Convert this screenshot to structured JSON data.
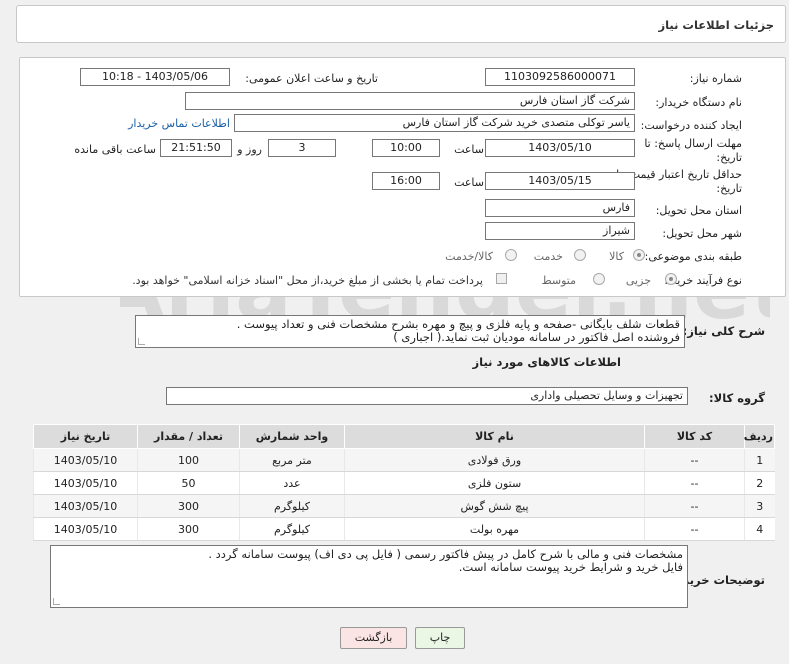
{
  "header": {
    "title": "جزئیات اطلاعات نیاز"
  },
  "form": {
    "need_number_label": "شماره نیاز:",
    "need_number": "1103092586000071",
    "announce_label": "تاریخ و ساعت اعلان عمومی:",
    "announce_value": "1403/05/06 - 10:18",
    "buyer_org_label": "نام دستگاه خریدار:",
    "buyer_org": "شرکت گاز استان فارس",
    "requester_label": "ایجاد کننده درخواست:",
    "requester": "یاسر توکلی متصدی خرید شرکت گاز استان فارس",
    "contact_link": "اطلاعات تماس خریدار",
    "reply_deadline_label_1": "مهلت ارسال پاسخ: تا",
    "reply_deadline_label_2": "تاریخ:",
    "reply_date": "1403/05/10",
    "time_label": "ساعت",
    "reply_time": "10:00",
    "days_value": "3",
    "days_label": "روز و",
    "remaining_time": "21:51:50",
    "remaining_label": "ساعت باقی مانده",
    "price_validity_label_1": "حداقل تاریخ اعتبار قیمت: تا",
    "price_validity_label_2": "تاریخ:",
    "price_date": "1403/05/15",
    "price_time": "16:00",
    "province_label": "استان محل تحویل:",
    "province": "فارس",
    "city_label": "شهر محل تحویل:",
    "city": "شیراز",
    "category_label": "طبقه بندی موضوعی:",
    "category_options": [
      "کالا",
      "خدمت",
      "کالا/خدمت"
    ],
    "purchase_type_label": "نوع فرآیند خرید :",
    "purchase_options": [
      "جزیی",
      "متوسط"
    ],
    "payment_note": "پرداخت تمام یا بخشی از مبلغ خرید،از محل \"اسناد خزانه اسلامی\" خواهد بود."
  },
  "description": {
    "label": "شرح کلی نیاز:",
    "line1": "قطعات شلف بایگانی -صفحه و پایه فلزی و پیچ و مهره بشرح مشخصات فنی و تعداد پیوست .",
    "line2": "فروشنده اصل فاکتور در سامانه مودیان ثبت نماید.( اجباری )"
  },
  "goods": {
    "section_title": "اطلاعات کالاهای مورد نیاز",
    "group_label": "گروه کالا:",
    "group_value": "تجهیزات و وسایل تحصیلی واداری",
    "columns": [
      "ردیف",
      "کد کالا",
      "نام کالا",
      "واحد شمارش",
      "تعداد / مقدار",
      "تاریخ نیاز"
    ],
    "rows": [
      {
        "idx": "1",
        "code": "--",
        "name": "ورق فولادی",
        "unit": "متر مربع",
        "qty": "100",
        "date": "1403/05/10"
      },
      {
        "idx": "2",
        "code": "--",
        "name": "ستون فلزی",
        "unit": "عدد",
        "qty": "50",
        "date": "1403/05/10"
      },
      {
        "idx": "3",
        "code": "--",
        "name": "پیچ شش گوش",
        "unit": "کیلوگرم",
        "qty": "300",
        "date": "1403/05/10"
      },
      {
        "idx": "4",
        "code": "--",
        "name": "مهره بولت",
        "unit": "کیلوگرم",
        "qty": "300",
        "date": "1403/05/10"
      }
    ]
  },
  "buyer_notes": {
    "label": "توضیحات خریدار:",
    "line1": "مشخصات فنی و مالی با شرح کامل در پیش فاکتور رسمی ( فایل پی دی اف) پیوست سامانه گردد .",
    "line2": "فایل خرید و شرایط خرید پیوست سامانه است."
  },
  "buttons": {
    "print": "چاپ",
    "back": "بازگشت"
  },
  "watermark_text": "AriaTender.net",
  "colors": {
    "link": "#1a5fa8",
    "print_btn": "#e9f7e4",
    "back_btn": "#fbe4e4"
  }
}
